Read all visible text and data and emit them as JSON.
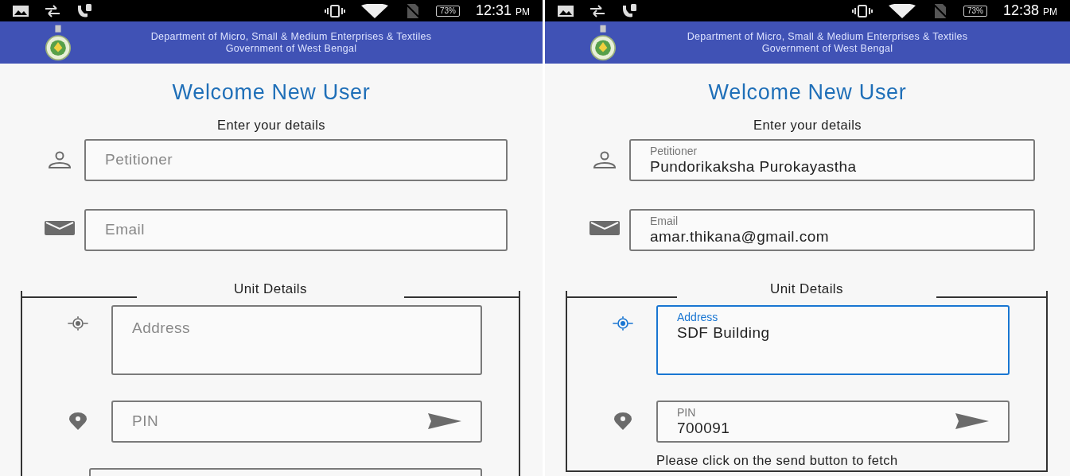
{
  "screens": [
    {
      "status_bar": {
        "battery": "73%",
        "time": "12:31",
        "meridiem": "PM"
      },
      "header": {
        "line_1": "Department of Micro, Small & Medium Enterprises & Textiles",
        "line_2": "Government of West Bengal"
      },
      "title": "Welcome New User",
      "subtitle": "Enter your details",
      "fields": [
        {
          "kind": "name",
          "label": "Petitioner",
          "focused": false
        },
        {
          "kind": "email",
          "label": "Email",
          "focused": false
        }
      ],
      "unit_section": {
        "legend": "Unit Details",
        "fields": [
          {
            "kind": "address",
            "label": "Address",
            "focused": false
          },
          {
            "kind": "pin",
            "label": "PIN",
            "focused": false
          },
          {
            "kind": "cut_off"
          }
        ]
      }
    },
    {
      "status_bar": {
        "battery": "73%",
        "time": "12:38",
        "meridiem": "PM"
      },
      "header": {
        "line_1": "Department of Micro, Small & Medium Enterprises & Textiles",
        "line_2": "Government of West Bengal"
      },
      "title": "Welcome New User",
      "subtitle": "Enter your details",
      "fields": [
        {
          "kind": "name",
          "label": "Petitioner",
          "value": "Pundorikaksha Purokayastha",
          "focused": false
        },
        {
          "kind": "email",
          "label": "Email",
          "value": "amar.thikana@gmail.com",
          "focused": false
        }
      ],
      "unit_section": {
        "legend": "Unit Details",
        "fields": [
          {
            "kind": "address",
            "label": "Address",
            "value": "SDF Building",
            "focused": true
          },
          {
            "kind": "pin",
            "label": "PIN",
            "value": "700091",
            "focused": false,
            "helper": "Please click on the send button to fetch"
          }
        ]
      }
    }
  ]
}
